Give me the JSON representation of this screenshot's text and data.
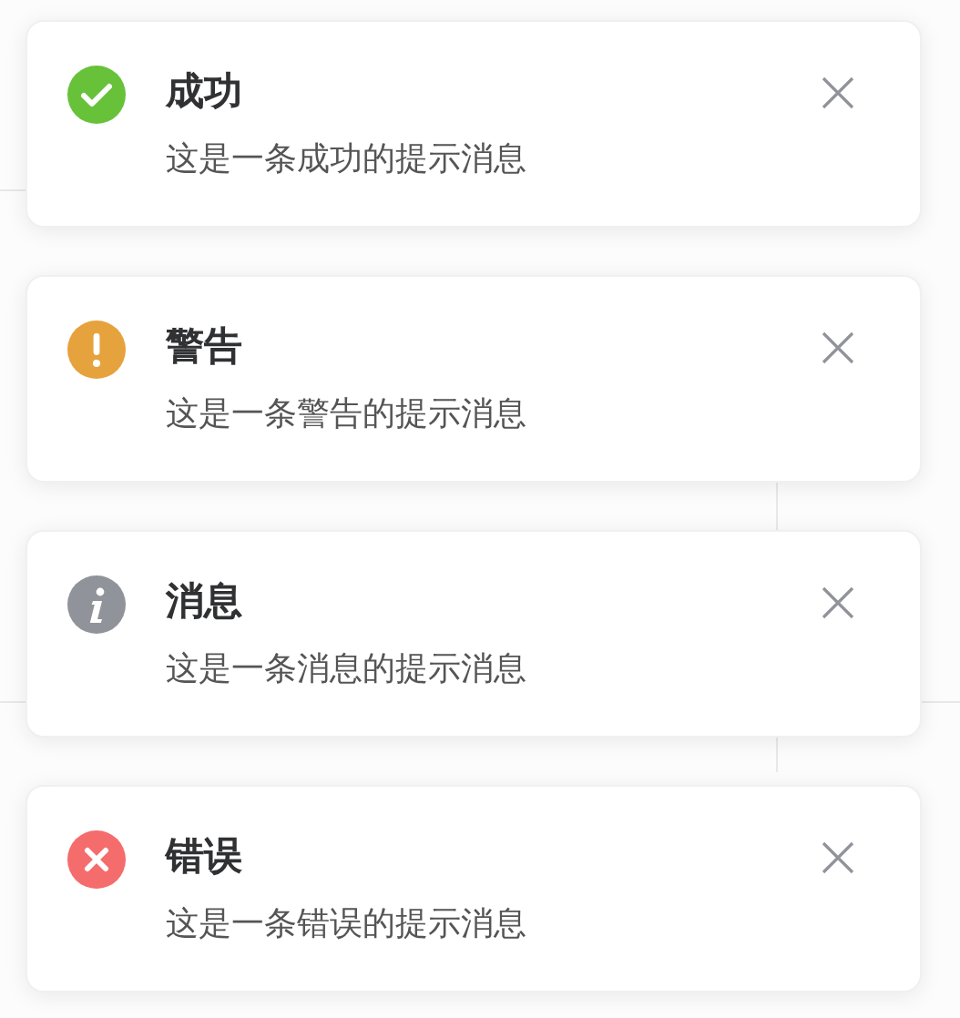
{
  "notifications": [
    {
      "kind": "success",
      "title": "成功",
      "message": "这是一条成功的提示消息"
    },
    {
      "kind": "warning",
      "title": "警告",
      "message": "这是一条警告的提示消息"
    },
    {
      "kind": "info",
      "title": "消息",
      "message": "这是一条消息的提示消息"
    },
    {
      "kind": "error",
      "title": "错误",
      "message": "这是一条错误的提示消息"
    }
  ]
}
